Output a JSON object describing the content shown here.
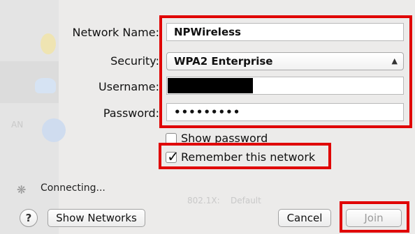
{
  "form": {
    "network_name_label": "Network Name:",
    "network_name_value": "NPWireless",
    "security_label": "Security:",
    "security_value": "WPA2 Enterprise",
    "username_label": "Username:",
    "password_label": "Password:",
    "password_value": "•••••••••",
    "show_password_label": "Show password",
    "remember_label": "Remember this network",
    "show_password_checked": false,
    "remember_checked": true
  },
  "status": {
    "text": "Connecting..."
  },
  "buttons": {
    "help": "?",
    "show_networks": "Show Networks",
    "cancel": "Cancel",
    "join": "Join"
  },
  "icons": {
    "spinner": "spinner-icon",
    "select_arrows": "updown-chevron-icon",
    "checkmark": "checkmark-icon"
  },
  "background_text": {
    "b1": "802.1X:",
    "b2": "Default",
    "b3": "AN"
  },
  "colors": {
    "highlight": "#e00000",
    "background": "#ecebea"
  }
}
